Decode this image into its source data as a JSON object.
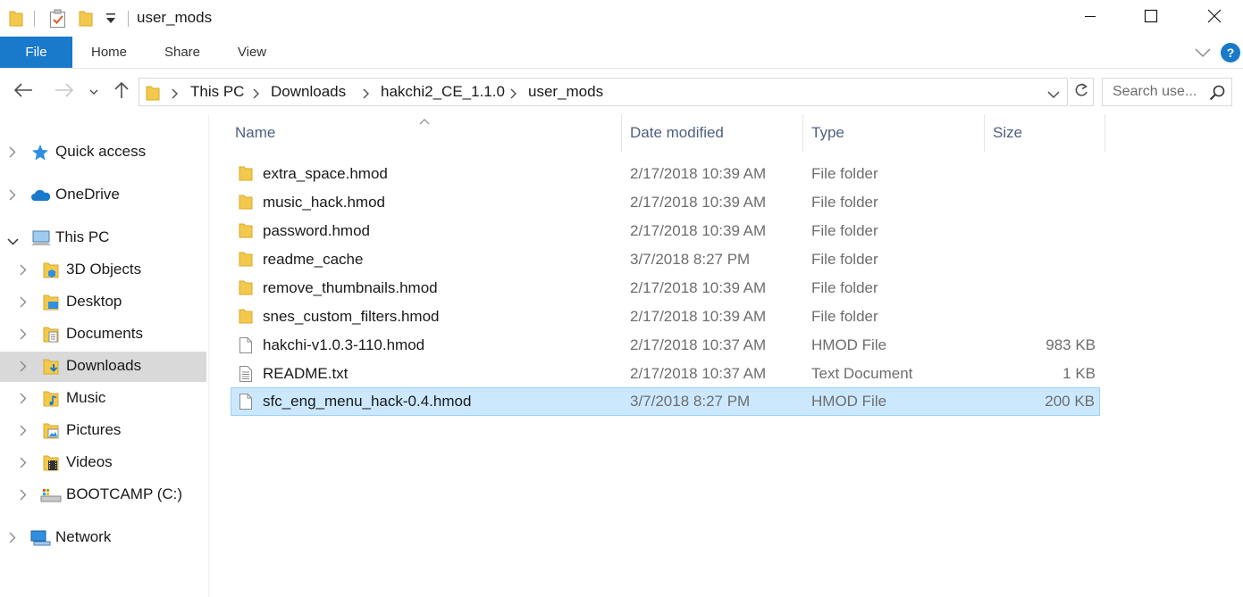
{
  "window": {
    "title": "user_mods",
    "minimize_icon": "minimize-icon",
    "maximize_icon": "maximize-icon",
    "close_icon": "close-icon"
  },
  "ribbon": {
    "tabs": [
      "File",
      "Home",
      "Share",
      "View"
    ],
    "help_label": "?"
  },
  "address": {
    "crumbs": [
      "This PC",
      "Downloads",
      "hakchi2_CE_1.1.0",
      "user_mods"
    ]
  },
  "search": {
    "placeholder": "Search use..."
  },
  "navpane": {
    "items": [
      {
        "label": "Quick access",
        "icon": "star-icon"
      },
      {
        "label": "OneDrive",
        "icon": "cloud-icon"
      },
      {
        "label": "This PC",
        "icon": "computer-icon",
        "expanded": true
      },
      {
        "label": "3D Objects",
        "icon": "3d-objects-icon"
      },
      {
        "label": "Desktop",
        "icon": "desktop-icon"
      },
      {
        "label": "Documents",
        "icon": "documents-icon"
      },
      {
        "label": "Downloads",
        "icon": "downloads-icon",
        "selected": true
      },
      {
        "label": "Music",
        "icon": "music-icon"
      },
      {
        "label": "Pictures",
        "icon": "pictures-icon"
      },
      {
        "label": "Videos",
        "icon": "videos-icon"
      },
      {
        "label": "BOOTCAMP (C:)",
        "icon": "drive-icon"
      },
      {
        "label": "Network",
        "icon": "network-icon"
      }
    ]
  },
  "filelist": {
    "columns": [
      "Name",
      "Date modified",
      "Type",
      "Size"
    ],
    "rows": [
      {
        "name": "extra_space.hmod",
        "date": "2/17/2018 10:39 AM",
        "type": "File folder",
        "size": "",
        "icon": "folder-icon"
      },
      {
        "name": "music_hack.hmod",
        "date": "2/17/2018 10:39 AM",
        "type": "File folder",
        "size": "",
        "icon": "folder-icon"
      },
      {
        "name": "password.hmod",
        "date": "2/17/2018 10:39 AM",
        "type": "File folder",
        "size": "",
        "icon": "folder-icon"
      },
      {
        "name": "readme_cache",
        "date": "3/7/2018 8:27 PM",
        "type": "File folder",
        "size": "",
        "icon": "folder-icon"
      },
      {
        "name": "remove_thumbnails.hmod",
        "date": "2/17/2018 10:39 AM",
        "type": "File folder",
        "size": "",
        "icon": "folder-icon"
      },
      {
        "name": "snes_custom_filters.hmod",
        "date": "2/17/2018 10:39 AM",
        "type": "File folder",
        "size": "",
        "icon": "folder-icon"
      },
      {
        "name": "hakchi-v1.0.3-110.hmod",
        "date": "2/17/2018 10:37 AM",
        "type": "HMOD File",
        "size": "983 KB",
        "icon": "file-icon"
      },
      {
        "name": "README.txt",
        "date": "2/17/2018 10:37 AM",
        "type": "Text Document",
        "size": "1 KB",
        "icon": "text-file-icon"
      },
      {
        "name": "sfc_eng_menu_hack-0.4.hmod",
        "date": "3/7/2018 8:27 PM",
        "type": "HMOD File",
        "size": "200 KB",
        "icon": "file-icon",
        "selected": true
      }
    ]
  },
  "colors": {
    "accent": "#1979ca",
    "folder": "#f2c94c",
    "selection": "#cce8ff",
    "selection_border": "#99d1ff",
    "nav_selected": "#d9d9d9"
  }
}
